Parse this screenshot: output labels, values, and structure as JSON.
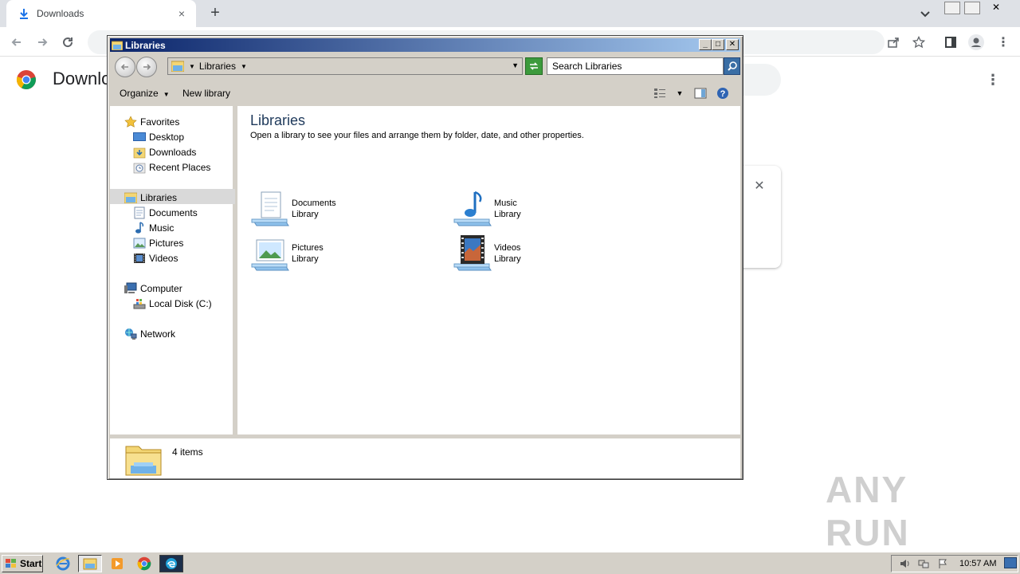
{
  "chrome": {
    "tab_title": "Downloads",
    "tab_close": "×",
    "new_tab": "+",
    "page_title": "Downloads",
    "kebab": "⋮",
    "card_close": "✕"
  },
  "explorer": {
    "window_title": "Libraries",
    "caption": {
      "minimize": "_",
      "maximize": "□",
      "close": "✕"
    },
    "address": {
      "crumb": "Libraries"
    },
    "search_placeholder": "Search Libraries",
    "commands": {
      "organize": "Organize",
      "new_library": "New library"
    },
    "nav": {
      "favorites": "Favorites",
      "desktop": "Desktop",
      "downloads": "Downloads",
      "recent_places": "Recent Places",
      "libraries": "Libraries",
      "documents": "Documents",
      "music": "Music",
      "pictures": "Pictures",
      "videos": "Videos",
      "computer": "Computer",
      "local_disk": "Local Disk (C:)",
      "network": "Network"
    },
    "content": {
      "heading": "Libraries",
      "description": "Open a library to see your files and arrange them by folder, date, and other properties.",
      "libraries": [
        {
          "name": "Documents",
          "type": "Library"
        },
        {
          "name": "Music",
          "type": "Library"
        },
        {
          "name": "Pictures",
          "type": "Library"
        },
        {
          "name": "Videos",
          "type": "Library"
        }
      ]
    },
    "details": {
      "item_count": "4 items"
    }
  },
  "taskbar": {
    "start_label": "Start",
    "clock": "10:57 AM"
  },
  "watermark": "ANY RUN",
  "colors": {
    "titlebar_start": "#0a246a",
    "titlebar_end": "#a6caf0",
    "heading": "#1e395b",
    "selection": "#d9d9d9"
  }
}
